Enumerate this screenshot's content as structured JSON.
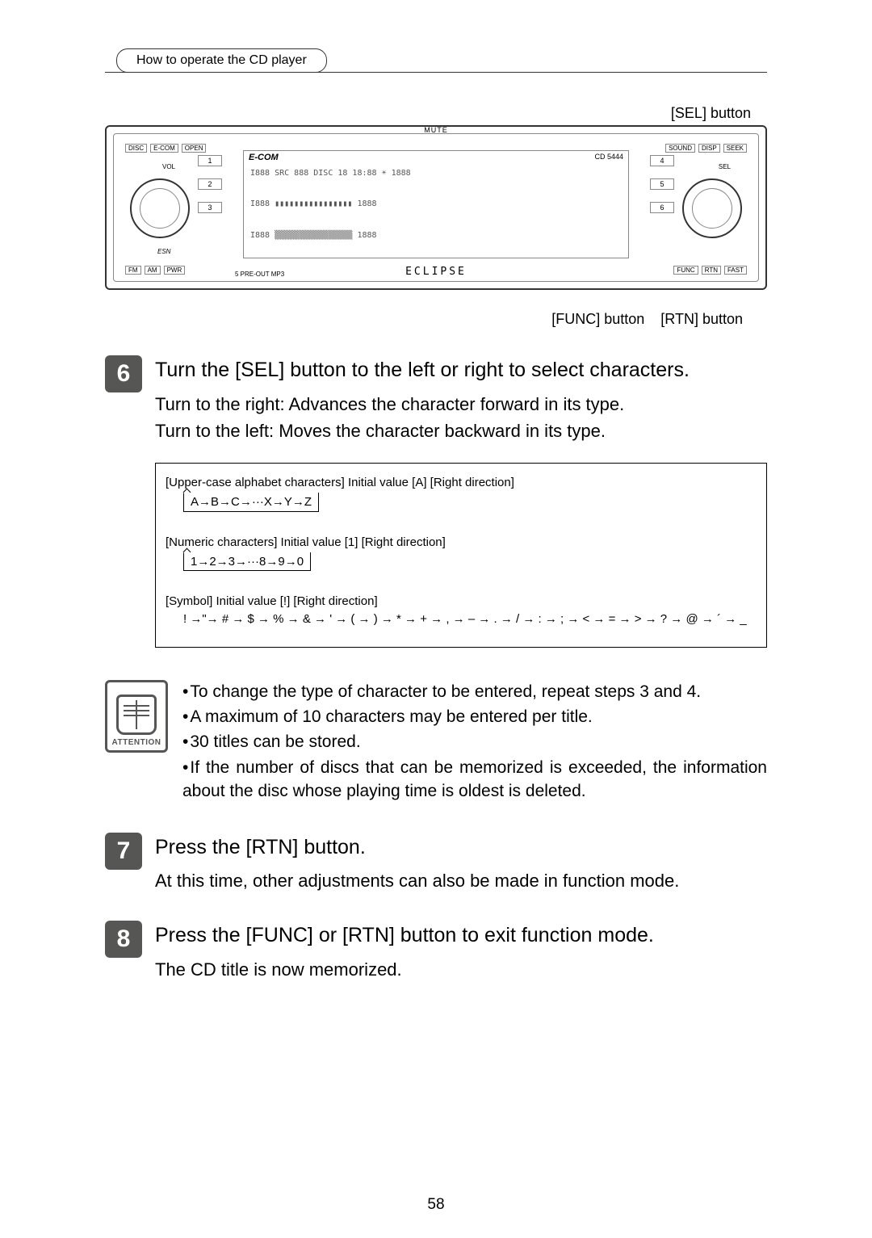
{
  "header": {
    "tab": "How to operate the CD player"
  },
  "callouts": {
    "sel": "[SEL] button",
    "func": "[FUNC] button",
    "rtn": "[RTN] button"
  },
  "device": {
    "top_small": "MUTE",
    "brand": "ECLIPSE",
    "model": "CD 5444",
    "logo": "E-COM",
    "topLeft": [
      "DISC",
      "E-COM",
      "OPEN"
    ],
    "topRight": [
      "SOUND",
      "DISP",
      "SEEK"
    ],
    "bottomLeft": [
      "FM",
      "AM",
      "PWR"
    ],
    "bottomLeftIn": "ESN",
    "bottomRight": [
      "FUNC",
      "RTN",
      "FAST"
    ],
    "leftNums": [
      "1",
      "2",
      "3"
    ],
    "rightNums": [
      "4",
      "5",
      "6"
    ],
    "knobLeftLabels": "VOL",
    "knobRightLabels": "SEL",
    "screen": {
      "l1": "I888 SRC 888 DISC 18 18:88  ☀  1888",
      "l2": "I888 ▮▮▮▮▮▮▮▮▮▮▮▮▮▮▮▮  1888",
      "l3": "I888 ▒▒▒▒▒▒▒▒▒▒▒▒▒▒▒▒  1888",
      "misc": "5 PRE-OUT    MP3"
    }
  },
  "steps": {
    "s6": {
      "num": "6",
      "title": "Turn the [SEL] button to the left or right to select characters.",
      "lines": [
        "Turn to the right:  Advances the character forward in its type.",
        "Turn to the left:    Moves the character backward in its type."
      ]
    },
    "s7": {
      "num": "7",
      "title": "Press the [RTN] button.",
      "body": "At this time, other adjustments can also be made in function mode."
    },
    "s8": {
      "num": "8",
      "title": "Press the [FUNC] or [RTN] button to exit function mode.",
      "body": "The CD title is now memorized."
    }
  },
  "charTable": {
    "upper": {
      "heading": "[Upper-case alphabet characters] Initial value [A]      [Right direction]",
      "seq": "A→B→C→···X→Y→Z"
    },
    "numeric": {
      "heading": "[Numeric characters] Initial value [1]      [Right direction]",
      "seq": "1→2→3→···8→9→0"
    },
    "symbol": {
      "heading": "[Symbol] Initial value [!]         [Right direction]",
      "seq": "! →\"→ # → $ → % → & → ' → ( → ) → * → + → , → – → . → / → : → ; → < → = → > → ? → @ → ´ → _"
    }
  },
  "attention": {
    "label": "ATTENTION",
    "items": [
      "To change the type of character to be entered, repeat steps 3 and 4.",
      "A maximum of 10 characters may be entered per title.",
      "30 titles can be stored.",
      "If the number of discs that can be memorized is exceeded, the information about the disc whose playing time is oldest is deleted."
    ]
  },
  "pageNumber": "58"
}
